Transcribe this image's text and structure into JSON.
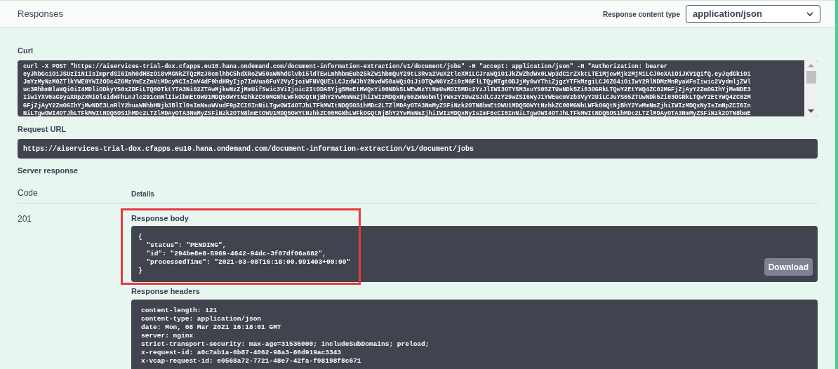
{
  "responses_header": {
    "title": "Responses",
    "content_type_label": "Response content type",
    "content_type_value": "application/json"
  },
  "curl": {
    "label": "Curl",
    "lines": [
      "curl -X POST \"https://aiservices-trial-dox.cfapps.eu10.hana.ondemand.com/document-information-extraction/v1/document/jobs\" -H \"accept: application/json\" -H \"Authorization: bearer",
      "eyJhbGciOiJSUzI1NiIsImprdSI6Imh0dHBzOi8vMGNkZTQzMzJ0cmlhbC5hdXRoZW50aWNhdGlvbi5ldTEwLmhhbmEub25kZW1hbmQuY29tL3Rva2VuX2tleXMiLCJraWQiOiJkZWZhdWx0LWp3dC1rZXktLTE1MjcwMjk2MjMiLCJ0eXAiOiJKV1QifQ.eyJqdGkiOi",
      "JmYzMyNzM0ZTlkYWE0YWI2ODc4ZGMzYmEzZmViMDcyNCIsImV4dF9hdHRyIjp7ImVuaGFuY2VyIjoiWFNVQUEiLCJzdWJhY2NvdW50aWQiOiJiOTQwNGYzZi0zMGFlLTQyMTgtODJjMy0wYThiZjgzYTFkMzgiLCJ6ZG4iOiIwY2RlNDMzMnRyaWFsIiwic2VydmljZWl",
      "uc3RhbmNlaWQiOiI4MDliODkyYS0xZDFiLTQ0OTktYTA3Ni02ZTAwMjkwNzZjMmUifSwic3ViIjoic2ItODA5Yjg5MmEtMWQxYi00NDk5LWEwNzYtNmUwMDI5MDc2YzJlIWI3OTY5M3xuYS05ZTUwNDk5Zi03OGRkLTQwY2EtYWQ4ZC02MGFjZjAyY2ZmOGIhYjMwNDE3",
      "IiwiYXV0aG9yaXRpZXMiOlsidWFhLnJlc291cmNlIiwibmEtOWU1MDQ5OWYtNzhkZC00MGNhLWFkOGQtNjBhY2YwMmNmZjhiIWIzMDQxNy50ZWNobmljYWxzY29wZSJdLCJzY29wZSI6WyJ1YWEucmVzb3VyY2UiLCJuYS05ZTUwNDk5Zi03OGRkLTQwY2EtYWQ4ZC02M",
      "GFjZjAyY2ZmOGIhYjMwNDE3LnRlY2huaWNhbHNjb3BlIl0sImNsaWVudF9pZCI6InNiLTgwOWI4OTJhLTFkMWItNDQ5OS1hMDc2LTZlMDAyOTA3NmMyZSFiNzk2OTN8bmEtOWU1MDQ5OWYtNzhkZC00MGNhLWFkOGQtNjBhY2YwMmNmZjhiIWIzMDQxNyIsImNpZCI6In",
      "NiLTgwOWI4OTJhLTFkMWItNDQ5OS1hMDc2LTZlMDAyOTA3NmMyZSFiNzk2OTN8bmEtOWU1MDQ5OWYtNzhkZC00MGNhLWFkOGQtNjBhY2YwMmNmZjhiIWIzMDQxNyIsImF6cCI6InNiLTgwOWI4OTJhLTFkMWItNDQ5OS1hMDc2LTZlMDAyOTA3NmMyZSFiNzk2OTN8bmE"
    ]
  },
  "request_url": {
    "label": "Request URL",
    "value": "https://aiservices-trial-dox.cfapps.eu10.hana.ondemand.com/document-information-extraction/v1/document/jobs"
  },
  "server_response": {
    "label": "Server response",
    "columns": [
      "Code",
      "Details"
    ],
    "rows": [
      {
        "code": "201",
        "body_label": "Response body",
        "body_highlighted": true,
        "body_lines": [
          "{",
          "  \"status\": \"PENDING\",",
          "  \"id\": \"294be8e8-5969-4642-94dc-3f07df06a682\",",
          "  \"processedTime\": \"2021-03-08T16:18:00.991403+00:00\"",
          "}"
        ],
        "download_button": "Download",
        "headers_label": "Response headers",
        "header_lines": [
          "content-length: 121",
          "content-type: application/json",
          "date: Mon, 08 Mar 2021 16:18:01 GMT",
          "server: nginx",
          "strict-transport-security: max-age=31536000; includeSubDomains; preload;",
          "x-request-id: a0c7ab1a-0b87-4062-98a3-86d919ac3343",
          "x-vcap-request-id: e0568a72-7721-48e7-42fa-f98198f8c671"
        ]
      }
    ]
  }
}
